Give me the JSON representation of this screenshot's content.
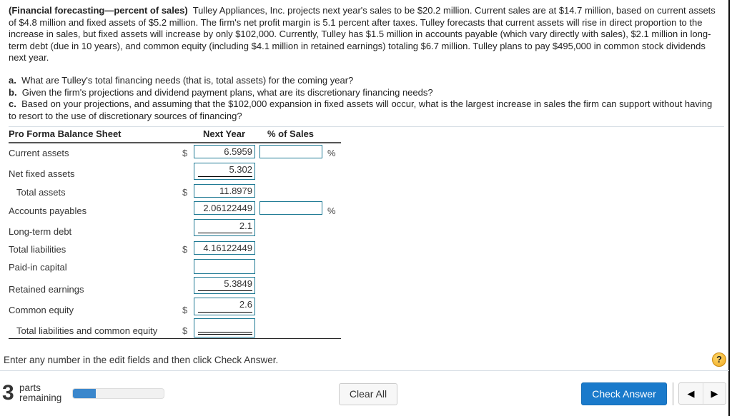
{
  "problem": {
    "title": "(Financial forecasting—percent of sales)",
    "text": "Tulley Appliances, Inc. projects next year's sales to be $20.2 million.  Current sales are at $14.7 million, based on current assets of $4.8 million and fixed assets of $5.2 million.  The firm's net profit margin is 5.1 percent after taxes.  Tulley forecasts that current assets will rise in direct proportion to the increase in sales, but fixed assets will increase by only $102,000.  Currently, Tulley has $1.5 million in accounts payable (which vary directly with sales), $2.1 million in long-term debt (due in 10 years), and common equity (including $4.1 million in retained earnings) totaling $6.7 million.  Tulley plans to pay $495,000 in common stock dividends next year."
  },
  "questions": [
    {
      "letter": "a.",
      "text": "What are Tulley's total financing needs (that is, total assets) for the coming year?"
    },
    {
      "letter": "b.",
      "text": "Given the firm's projections and dividend payment plans, what are its discretionary financing needs?"
    },
    {
      "letter": "c.",
      "text": "Based on your projections, and assuming that the $102,000 expansion in fixed assets will occur, what is the largest increase in sales the firm can support without having to resort to the use of discretionary sources of financing?"
    }
  ],
  "balance_sheet": {
    "headers": {
      "label": "Pro Forma Balance Sheet",
      "next_year": "Next Year",
      "pct_sales": "% of Sales"
    },
    "currency": "$",
    "pct_symbol": "%",
    "rows": [
      {
        "label": "Current assets",
        "value": "6.5959",
        "pct_value": ""
      },
      {
        "label": "Net fixed assets",
        "value": "5.302"
      },
      {
        "label": "Total assets",
        "value": "11.8979"
      },
      {
        "label": "Accounts payables",
        "value": "2.06122449",
        "pct_value": ""
      },
      {
        "label": "Long-term debt",
        "value": "2.1"
      },
      {
        "label": "Total liabilities",
        "value": "4.16122449"
      },
      {
        "label": "Paid-in capital",
        "value": ""
      },
      {
        "label": "Retained earnings",
        "value": "5.3849"
      },
      {
        "label": "Common equity",
        "value": "2.6"
      },
      {
        "label": "Total liabilities and common equity",
        "value": ""
      }
    ]
  },
  "footer": {
    "instruction": "Enter any number in the edit fields and then click Check Answer.",
    "help_label": "?",
    "parts_count": "3",
    "parts_label_1": "parts",
    "parts_label_2": "remaining",
    "progress_fraction": 0.25,
    "clear_all": "Clear All",
    "check_answer": "Check Answer",
    "prev_glyph": "◀",
    "next_glyph": "▶"
  }
}
